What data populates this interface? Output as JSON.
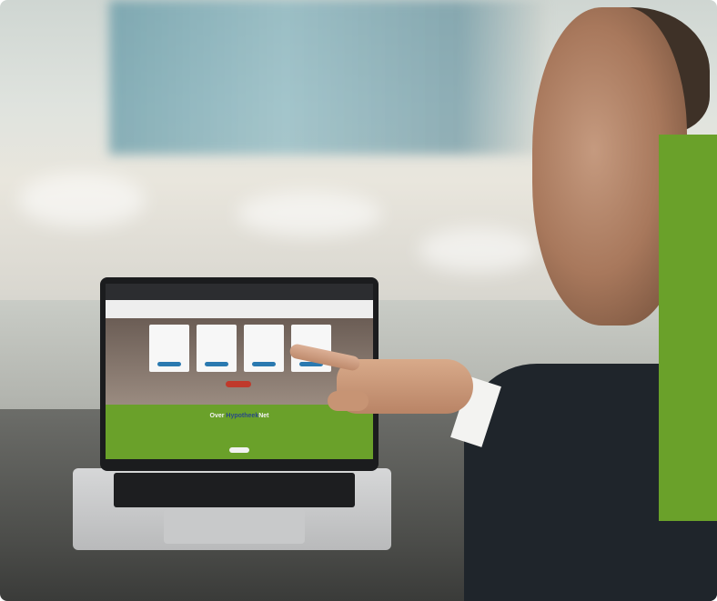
{
  "photo": {
    "subject": "man pointing at laptop screen",
    "accent_color": "#6aa12a"
  },
  "laptop_screen": {
    "heading_part1": "Over",
    "heading_part2": "Hypotheek",
    "heading_part3": "Net",
    "heading_color_1": "#ffffff",
    "heading_color_2": "#2b4a86",
    "green_color": "#6aa12a"
  }
}
